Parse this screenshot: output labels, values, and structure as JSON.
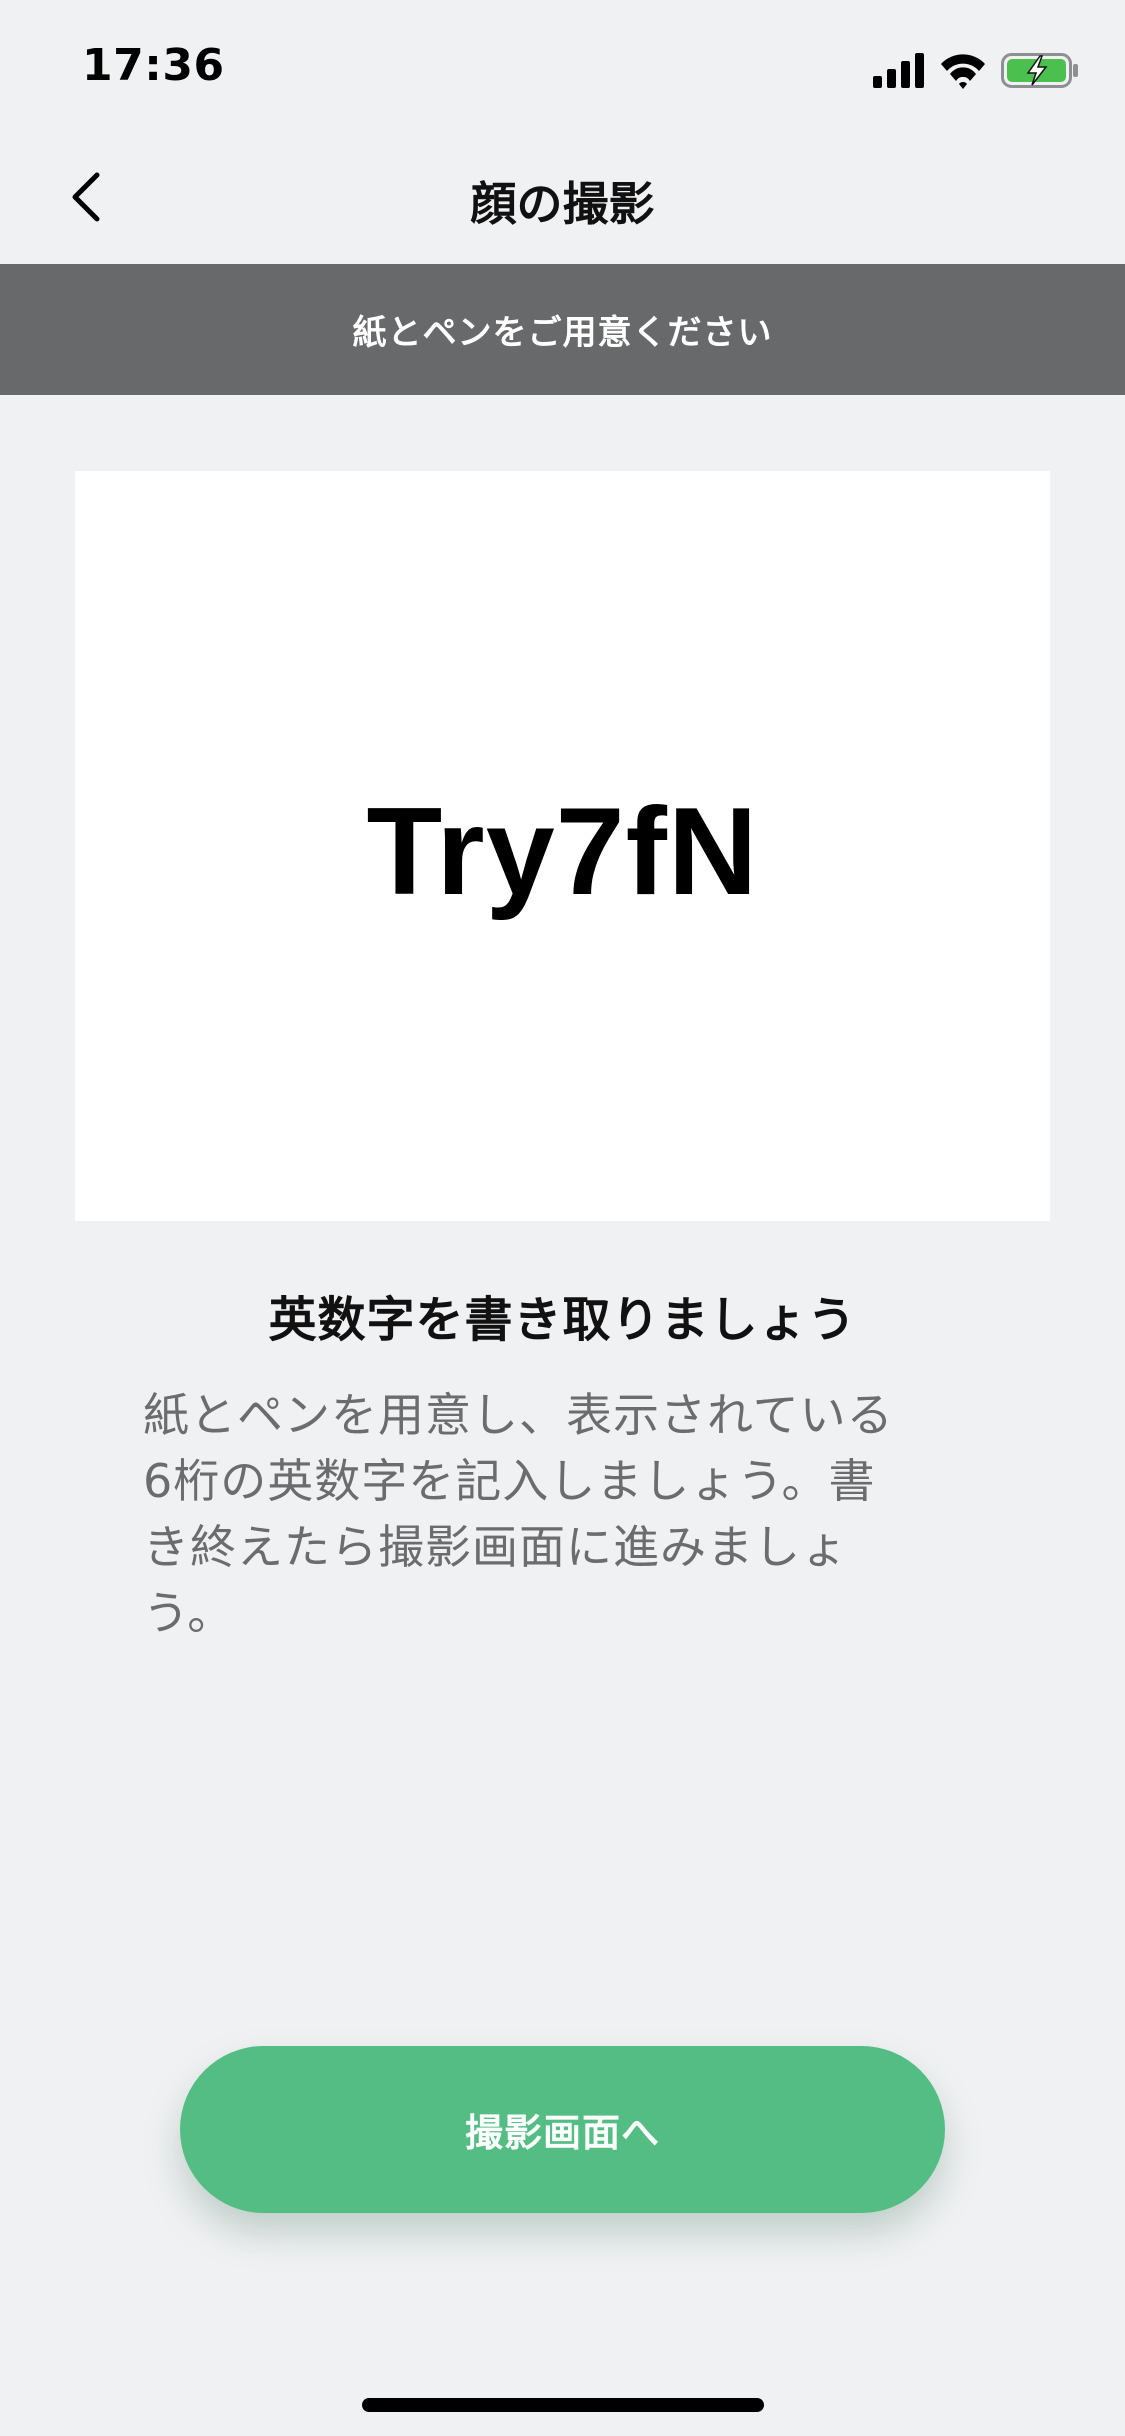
{
  "status_bar": {
    "time": "17:36",
    "icons": [
      "cellular-signal-icon",
      "wifi-icon",
      "battery-charging-icon"
    ],
    "battery_color": "#4cc04f"
  },
  "nav": {
    "title": "顔の撮影",
    "back_icon": "chevron-left-icon"
  },
  "banner": {
    "text": "紙とペンをご用意ください",
    "background": "#68696b"
  },
  "code_card": {
    "code": "Try7fN"
  },
  "instructions": {
    "heading": "英数字を書き取りましょう",
    "body_lines": [
      "紙とペンを用意し、表示されている",
      "6桁の英数字を記入しましょう。書",
      "き終えたら撮影画面に進みましょ",
      "う。"
    ]
  },
  "primary_button": {
    "label": "撮影画面へ",
    "color": "#53bd84"
  }
}
